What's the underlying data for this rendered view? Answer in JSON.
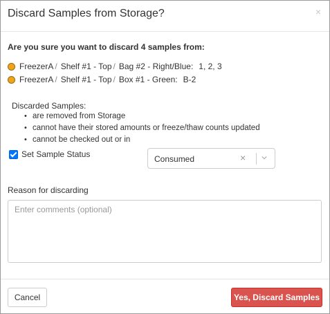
{
  "dialog": {
    "title": "Discard Samples from Storage?",
    "close_glyph": "×",
    "question": "Are you sure you want to discard 4 samples from:"
  },
  "locations": [
    {
      "path": [
        "FreezerA",
        "Shelf #1 - Top",
        "Bag #2 - Right/Blue:"
      ],
      "separator": "/",
      "positions": "1, 2, 3",
      "status_color": "#f0a41c"
    },
    {
      "path": [
        "FreezerA",
        "Shelf #1 - Top",
        "Box #1 - Green:"
      ],
      "separator": "/",
      "positions": "B-2",
      "status_color": "#f0a41c"
    }
  ],
  "discarded": {
    "title": "Discarded Samples:",
    "items": [
      "are removed from Storage",
      "cannot have their stored amounts or freeze/thaw counts updated",
      "cannot be checked out or in"
    ]
  },
  "set_status": {
    "checkbox_label": "Set Sample Status",
    "checked": true,
    "selected": "Consumed"
  },
  "reason": {
    "label": "Reason for discarding",
    "placeholder": "Enter comments (optional)"
  },
  "footer": {
    "cancel_label": "Cancel",
    "confirm_label": "Yes, Discard Samples"
  },
  "colors": {
    "danger": "#d9534f",
    "checkbox": "#0075ff",
    "location_dot": "#f0a41c"
  }
}
